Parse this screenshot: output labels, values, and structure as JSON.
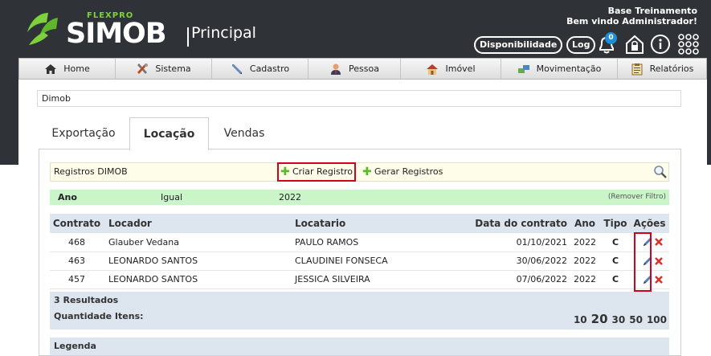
{
  "app": {
    "brand_small": "FLEXPRO",
    "brand": "SIMOB",
    "module": "Principal"
  },
  "user": {
    "company": "Base Treinamento",
    "welcome": "Bem vindo Administrador!"
  },
  "header": {
    "availability_label": "Disponibilidade",
    "log_label": "Log",
    "notification_count": "0"
  },
  "menu": [
    {
      "label": "Home",
      "icon": "home-icon"
    },
    {
      "label": "Sistema",
      "icon": "tools-icon"
    },
    {
      "label": "Cadastro",
      "icon": "pen-icon"
    },
    {
      "label": "Pessoa",
      "icon": "person-icon"
    },
    {
      "label": "Imóvel",
      "icon": "house-icon"
    },
    {
      "label": "Movimentação",
      "icon": "transfer-icon"
    },
    {
      "label": "Relatórios",
      "icon": "clipboard-icon"
    }
  ],
  "breadcrumb": "Dimob",
  "tabs": [
    {
      "label": "Exportação"
    },
    {
      "label": "Locação"
    },
    {
      "label": "Vendas"
    }
  ],
  "toolbar": {
    "title": "Registros DIMOB",
    "create_label": "Criar Registro",
    "generate_label": "Gerar Registros"
  },
  "filter": {
    "field": "Ano",
    "operator": "Igual",
    "value": "2022",
    "remove_label": "(Remover Filtro)"
  },
  "table": {
    "headers": {
      "contrato": "Contrato",
      "locador": "Locador",
      "locatario": "Locatario",
      "data": "Data do contrato",
      "ano": "Ano",
      "tipo": "Tipo",
      "acoes": "Ações"
    },
    "rows": [
      {
        "contrato": "468",
        "locador": "Glauber Vedana",
        "locatario": "PAULO RAMOS",
        "data": "01/10/2021",
        "ano": "2022",
        "tipo": "C"
      },
      {
        "contrato": "463",
        "locador": "LEONARDO SANTOS",
        "locatario": "CLAUDINEI FONSECA",
        "data": "30/06/2022",
        "ano": "2022",
        "tipo": "C"
      },
      {
        "contrato": "457",
        "locador": "LEONARDO SANTOS",
        "locatario": "JESSICA SILVEIRA",
        "data": "07/06/2022",
        "ano": "2022",
        "tipo": "C"
      }
    ]
  },
  "results": "3 Resultados",
  "page_size": {
    "label": "Quantidade Itens:",
    "options": [
      "10",
      "20",
      "30",
      "50",
      "100"
    ],
    "selected": "20"
  },
  "legend_title": "Legenda",
  "colors": {
    "header_bg": "#2f3236",
    "brand_green": "#7ed13d",
    "filter_bg": "#c9f5c9",
    "table_header_bg": "#dde5ef",
    "highlight": "#d0021b"
  }
}
